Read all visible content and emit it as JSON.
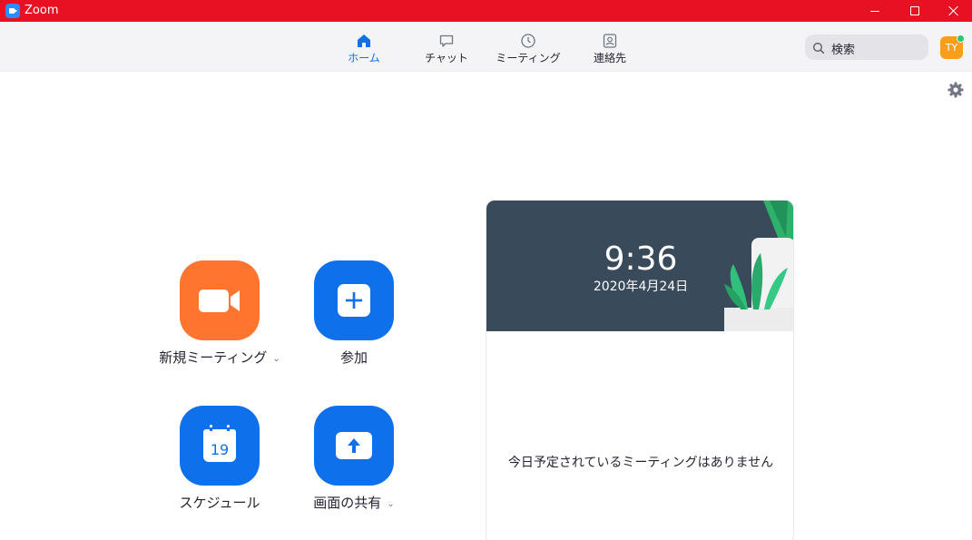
{
  "window": {
    "title": "Zoom"
  },
  "nav": {
    "tabs": [
      {
        "label": "ホーム",
        "icon": "home-icon",
        "active": true
      },
      {
        "label": "チャット",
        "icon": "chat-icon",
        "active": false
      },
      {
        "label": "ミーティング",
        "icon": "clock-icon",
        "active": false
      },
      {
        "label": "連絡先",
        "icon": "contacts-icon",
        "active": false
      }
    ],
    "search_placeholder": "検索",
    "avatar_initials": "TY"
  },
  "actions": {
    "new_meeting": "新規ミーティング",
    "join": "参加",
    "schedule": "スケジュール",
    "schedule_day": "19",
    "share_screen": "画面の共有"
  },
  "panel": {
    "time": "9:36",
    "date": "2020年4月24日",
    "empty_message": "今日予定されているミーティングはありません"
  },
  "colors": {
    "title_bar": "#e81123",
    "accent_blue": "#0e71eb",
    "new_meeting_orange": "#ff742e",
    "banner": "#394a5b",
    "avatar": "#f79e1b",
    "presence": "#2ac96e"
  }
}
